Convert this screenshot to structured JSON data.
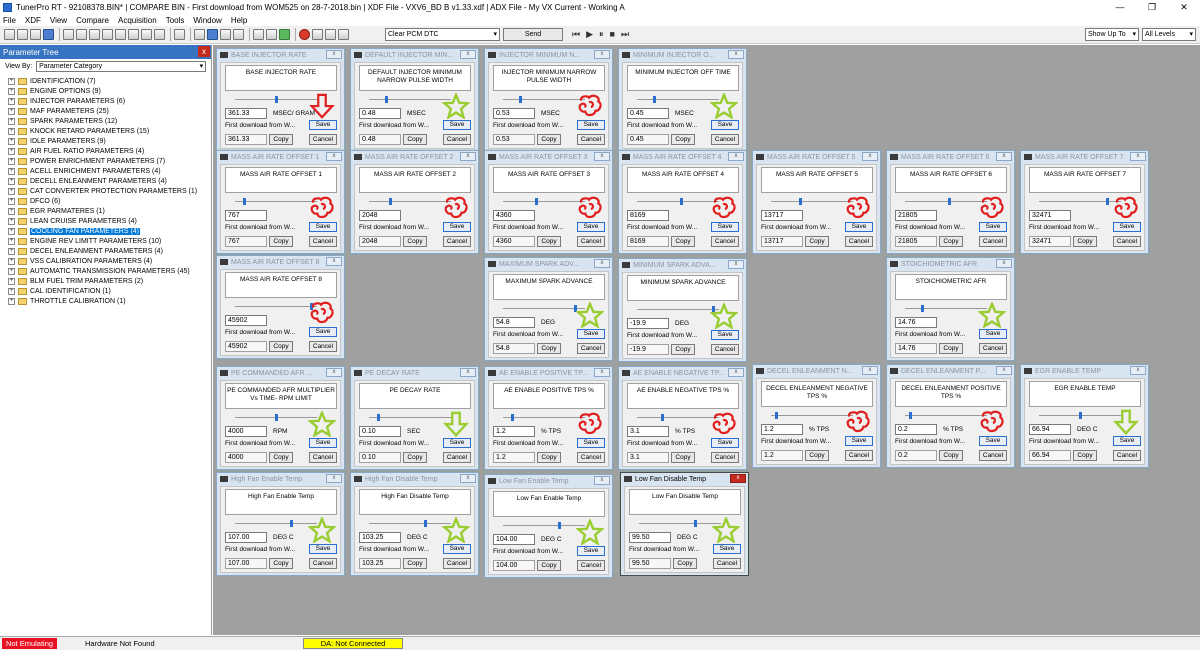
{
  "window": {
    "title": "TunerPro RT - 92108378.BIN* | COMPARE BIN - First download from WOM525 on 28-7-2018.bin | XDF File - VXV6_BD B v1.33.xdf | ADX File - My VX Current - Working A"
  },
  "menu": [
    "File",
    "XDF",
    "View",
    "Compare",
    "Acquisition",
    "Tools",
    "Window",
    "Help"
  ],
  "toolbar": {
    "pcm_select": "Clear PCM DTC",
    "send_label": "Send",
    "show_up_to": "Show Up To",
    "levels": "All Levels"
  },
  "tree": {
    "title": "Parameter Tree",
    "close": "x",
    "view_by_label": "View By:",
    "view_by_value": "Parameter Category",
    "items": [
      "IDENTIFICATION (7)",
      "ENGINE OPTIONS (9)",
      "INJECTOR PARAMETERS (6)",
      "MAF PARAMETERS (25)",
      "SPARK PARAMETERS (12)",
      "KNOCK RETARD PARAMETERS (15)",
      "IDLE PARAMETERS (9)",
      "AIR FUEL RATIO PARAMETERS (4)",
      "POWER ENRICHMENT PARAMETERS (7)",
      "ACELL ENRICHMENT PARAMETERS (4)",
      "DECELL ENLEANMENT PARAMETERS (4)",
      "CAT CONVERTER PROTECTION PARAMETERS (1)",
      "DFCO (6)",
      "EGR PARMATERES (1)",
      "LEAN CRUISE PARAMETERS (4)",
      "COOLING FAN PARAMETERS (4)",
      "ENGINE REV LIMITT PARAMETERS (10)",
      "DECEL ENLEANMENT PARAMETERS (4)",
      "VSS CALIBRATION PARAMETERS (4)",
      "AUTOMATIC TRANSMISSION PARAMETERS (45)",
      "BLM FUEL TRIM PARAMETERS (2)",
      "CAL IDENTIFICATION (1)",
      "THROTTLE CALIBRATION (1)"
    ],
    "selected": "COOLING FAN PARAMETERS (4)"
  },
  "common": {
    "source": "First download from W...",
    "save": "Save",
    "copy": "Copy",
    "cancel": "Cancel",
    "close": "x"
  },
  "windows": [
    {
      "title": "BASE INJECTOR RATE",
      "label": "BASE INJECTOR RATE",
      "value": "361.33",
      "unit": "MSEC/ GRAM",
      "orig": "361.33",
      "mark": "arrow-red",
      "pos": 0.5
    },
    {
      "title": "DEFAULT INJECTOR MIN...",
      "label": "DEFAULT INJECTOR MINIMUM NARROW PULSE WIDTH",
      "value": "0.48",
      "unit": "MSEC",
      "orig": "0.48",
      "mark": "star",
      "pos": 0.2
    },
    {
      "title": "INJECTOR MINIMUM N...",
      "label": "INJECTOR MINIMUM NARROW PULSE WIDTH",
      "value": "0.53",
      "unit": "MSEC",
      "orig": "0.53",
      "mark": "scribble",
      "pos": 0.2
    },
    {
      "title": "MINIMUM INJECTOR O...",
      "label": "MINIMUM INJECTOR OFF TIME",
      "value": "0.45",
      "unit": "MSEC",
      "orig": "0.45",
      "mark": "star",
      "pos": 0.2
    },
    {
      "title": "MASS AIR RATE OFFSET 1",
      "label": "MASS AIR RATE OFFSET 1",
      "value": "767",
      "unit": "",
      "orig": "767",
      "mark": "scribble",
      "pos": 0.1
    },
    {
      "title": "MASS AIR RATE OFFSET 2",
      "label": "MASS AIR RATE OFFSET 2",
      "value": "2048",
      "unit": "",
      "orig": "2048",
      "mark": "scribble",
      "pos": 0.25
    },
    {
      "title": "MASS AIR RATE OFFSET 3",
      "label": "MASS AIR RATE OFFSET 3",
      "value": "4360",
      "unit": "",
      "orig": "4360",
      "mark": "scribble",
      "pos": 0.4
    },
    {
      "title": "MASS AIR RATE OFFSET 4",
      "label": "MASS AIR RATE OFFSET 4",
      "value": "8169",
      "unit": "",
      "orig": "8169",
      "mark": "scribble",
      "pos": 0.55
    },
    {
      "title": "MASS AIR RATE OFFSET 5",
      "label": "MASS AIR RATE OFFSET 5",
      "value": "13717",
      "unit": "",
      "orig": "13717",
      "mark": "scribble",
      "pos": 0.35
    },
    {
      "title": "MASS AIR RATE OFFSET 6",
      "label": "MASS AIR RATE OFFSET 6",
      "value": "21805",
      "unit": "",
      "orig": "21805",
      "mark": "scribble",
      "pos": 0.55
    },
    {
      "title": "MASS AIR RATE OFFSET 7",
      "label": "MASS AIR RATE OFFSET 7",
      "value": "32471",
      "unit": "",
      "orig": "32471",
      "mark": "scribble",
      "pos": 0.85
    },
    {
      "title": "MASS AIR RATE OFFSET 8",
      "label": "MASS AIR RATE OFFSET 8",
      "value": "45902",
      "unit": "",
      "orig": "45902",
      "mark": "scribble",
      "pos": 0.95
    },
    {
      "title": "MAXIMUM SPARK ADV...",
      "label": "MAXIMUM SPARK ADVANCE",
      "value": "54.8",
      "unit": "DEG",
      "orig": "54.8",
      "mark": "star",
      "pos": 0.9
    },
    {
      "title": "MINIMUM SPARK ADVA...",
      "label": "MINIMUM SPARK ADVANCE",
      "value": "-19.9",
      "unit": "DEG",
      "orig": "-19.9",
      "mark": "star",
      "pos": 0.95
    },
    {
      "title": "STOICHIOMETRIC AFR",
      "label": "STOICHIOMETRIC AFR",
      "value": "14.76",
      "unit": "",
      "orig": "14.76",
      "mark": "star",
      "pos": 0.2
    },
    {
      "title": "PE COMMANDED AFR ...",
      "label": "PE COMMANDED AFR MULTIPLIER Vs TIME- RPM LIMIT",
      "value": "4000",
      "unit": "RPM",
      "orig": "4000",
      "mark": "star",
      "pos": 0.5
    },
    {
      "title": "PE DECAY RATE",
      "label": "PE DECAY RATE",
      "value": "0.10",
      "unit": "SEC",
      "orig": "0.10",
      "mark": "arrow-green",
      "pos": 0.1
    },
    {
      "title": "AE ENABLE POSITIVE TP...",
      "label": "AE ENABLE POSITIVE TPS %",
      "value": "1.2",
      "unit": "% TPS",
      "orig": "1.2",
      "mark": "scribble",
      "pos": 0.1
    },
    {
      "title": "AE ENABLE NEGATIVE TP...",
      "label": "AE ENABLE NEGATIVE TPS %",
      "value": "3.1",
      "unit": "% TPS",
      "orig": "3.1",
      "mark": "scribble",
      "pos": 0.3
    },
    {
      "title": "DECEL ENLEANMENT N...",
      "label": "DECEL ENLEANMENT NEGATIVE TPS %",
      "value": "1.2",
      "unit": "% TPS",
      "orig": "1.2",
      "mark": "scribble",
      "pos": 0.05
    },
    {
      "title": "DECEL ENLEANMENT P...",
      "label": "DECEL ENLEANMENT POSITIVE TPS %",
      "value": "0.2",
      "unit": "% TPS",
      "orig": "0.2",
      "mark": "scribble",
      "pos": 0.05
    },
    {
      "title": "EGR ENABLE TEMP",
      "label": "EGR ENABLE TEMP",
      "value": "66.94",
      "unit": "DEG C",
      "orig": "66.94",
      "mark": "arrow-green",
      "pos": 0.5
    },
    {
      "title": "High Fan Enable Temp",
      "label": "High Fan Enable Temp",
      "value": "107.00",
      "unit": "DEG C",
      "orig": "107.00",
      "mark": "star",
      "pos": 0.7
    },
    {
      "title": "High Fan Disable Temp",
      "label": "High Fan Disable Temp",
      "value": "103.25",
      "unit": "DEG C",
      "orig": "103.25",
      "mark": "star",
      "pos": 0.7
    },
    {
      "title": "Low Fan Enable Temp",
      "label": "Low Fan Enable Temp",
      "value": "104.00",
      "unit": "DEG C",
      "orig": "104.00",
      "mark": "star",
      "pos": 0.7
    },
    {
      "title": "Low Fan Disable Temp",
      "label": "Low Fan Disable Temp",
      "value": "99.50",
      "unit": "DEG C",
      "orig": "99.50",
      "mark": "star",
      "pos": 0.7,
      "active": true
    }
  ],
  "status": {
    "emulating": "Not Emulating",
    "hardware": "Hardware Not Found",
    "da": "DA: Not Connected"
  }
}
